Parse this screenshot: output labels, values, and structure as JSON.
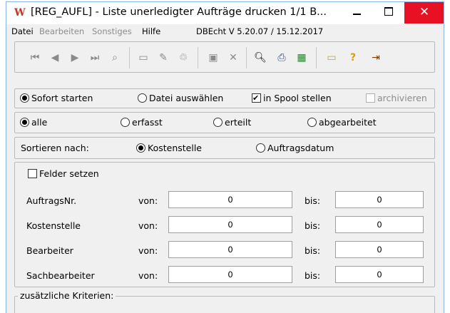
{
  "window": {
    "icon_letter": "W",
    "title": "[REG_AUFL] - Liste unerledigter Aufträge drucken  1/1  B...",
    "close_glyph": "✕"
  },
  "menu": {
    "items": [
      "Datei",
      "Bearbeiten",
      "Sonstiges",
      "Hilfe"
    ],
    "version": "DBEcht V 5.20.07 / 15.12.2017"
  },
  "toolbar": {
    "icons": [
      "first-record-icon",
      "prev-record-icon",
      "next-record-icon",
      "last-record-icon",
      "binoculars-icon",
      "new-document-icon",
      "edit-document-icon",
      "trash-icon",
      "save-icon",
      "cancel-icon",
      "print-preview-icon",
      "print-icon",
      "grid-icon",
      "folder-icon",
      "help-icon",
      "exit-door-icon"
    ]
  },
  "output": {
    "sofort": "Sofort starten",
    "datei": "Datei auswählen",
    "spool": "in Spool stellen",
    "archiv": "archivieren"
  },
  "status": {
    "alle": "alle",
    "erfasst": "erfasst",
    "erteilt": "erteilt",
    "abgearbeitet": "abgearbeitet"
  },
  "sort": {
    "label": "Sortieren nach:",
    "kostenstelle": "Kostenstelle",
    "datum": "Auftragsdatum"
  },
  "fields": {
    "setzen": "Felder setzen",
    "von": "von:",
    "bis": "bis:",
    "rows": [
      {
        "label": "AuftragsNr.",
        "von": "0",
        "bis": "0"
      },
      {
        "label": "Kostenstelle",
        "von": "0",
        "bis": "0"
      },
      {
        "label": "Bearbeiter",
        "von": "0",
        "bis": "0"
      },
      {
        "label": "Sachbearbeiter",
        "von": "0",
        "bis": "0"
      }
    ]
  },
  "extra": {
    "label": "zusätzliche Kriterien:"
  }
}
